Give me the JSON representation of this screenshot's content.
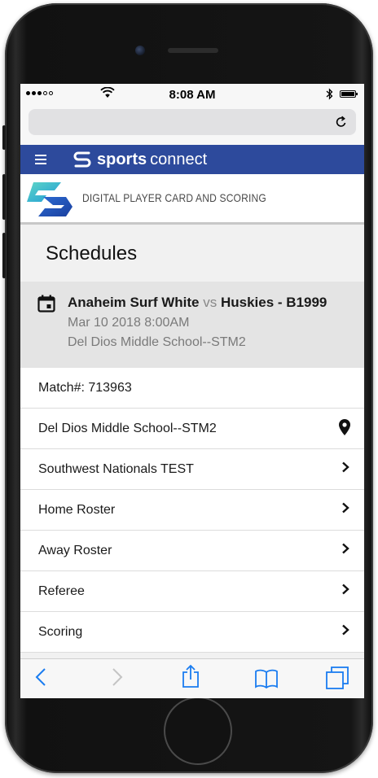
{
  "status_bar": {
    "time": "8:08 AM",
    "bluetooth": "bluetooth-icon",
    "battery": "battery-icon"
  },
  "browser": {
    "url": "",
    "reload": "reload-icon"
  },
  "nav": {
    "brand_bold": "sports",
    "brand_light": "connect",
    "color": "#2d4a9c"
  },
  "banner": {
    "text": "DIGITAL PLAYER CARD AND SCORING"
  },
  "page": {
    "title": "Schedules"
  },
  "match": {
    "home": "Anaheim Surf White",
    "vs": "vs",
    "away": "Huskies - B1999",
    "datetime": "Mar 10 2018 8:00AM",
    "venue": "Del Dios Middle School--STM2"
  },
  "rows": [
    {
      "label": "Match#: 713963",
      "icon": ""
    },
    {
      "label": "Del Dios Middle School--STM2",
      "icon": "location-pin-icon"
    },
    {
      "label": "Southwest Nationals TEST",
      "icon": "chevron-right-icon"
    },
    {
      "label": "Home Roster",
      "icon": "chevron-right-icon"
    },
    {
      "label": "Away Roster",
      "icon": "chevron-right-icon"
    },
    {
      "label": "Referee",
      "icon": "chevron-right-icon"
    },
    {
      "label": "Scoring",
      "icon": "chevron-right-icon"
    }
  ],
  "toolbar": {
    "accent": "#1a7cf0",
    "items": [
      "back-icon",
      "forward-icon",
      "share-icon",
      "bookmarks-icon",
      "tabs-icon"
    ]
  }
}
